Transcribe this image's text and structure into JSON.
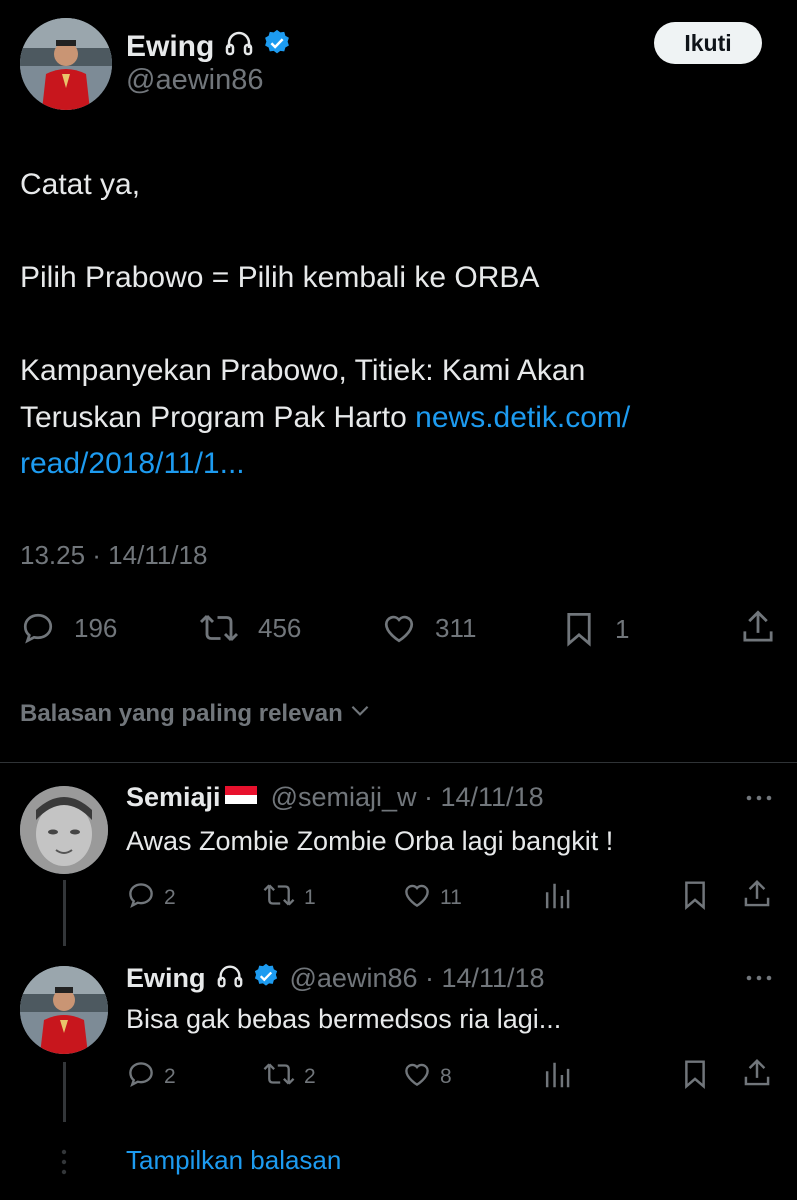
{
  "tweet": {
    "author": {
      "name": "Ewing",
      "handle": "@aewin86",
      "badge_icon": "headphones-icon",
      "verified_color": "#1d9bf0"
    },
    "follow_label": "Ikuti",
    "text_lines": {
      "line1": "Catat ya,",
      "line2": "Pilih Prabowo = Pilih kembali ke ORBA",
      "line3": "Kampanyekan Prabowo, Titiek: Kami Akan",
      "line4_text": "Teruskan Program Pak Harto ",
      "line4_link": "news.detik.com/",
      "line5_link": "read/2018/11/1..."
    },
    "timestamp": "13.25 · 14/11/18",
    "stats": {
      "replies": "196",
      "retweets": "456",
      "likes": "311",
      "bookmarks": "1"
    }
  },
  "sort_label": "Balasan yang paling relevan",
  "replies": [
    {
      "name": "Semiaji",
      "flag": "indonesia-flag",
      "handle_time": "@semiaji_w · 14/11/18",
      "text": "Awas Zombie Zombie Orba lagi bangkit !",
      "replies": "2",
      "retweets": "1",
      "likes": "11"
    },
    {
      "name": "Ewing",
      "handle_time": "@aewin86 · 14/11/18",
      "text": "Bisa gak bebas bermedsos ria lagi...",
      "replies": "2",
      "retweets": "2",
      "likes": "8"
    }
  ],
  "show_replies_label": "Tampilkan balasan",
  "colors": {
    "background": "#000000",
    "text": "#e7e9ea",
    "muted": "#71767b",
    "link": "#1d9bf0"
  }
}
